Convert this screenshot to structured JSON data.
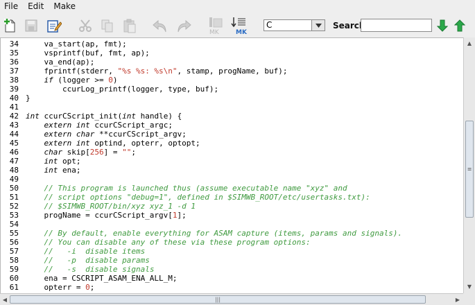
{
  "menu": {
    "file": "File",
    "edit": "Edit",
    "make": "Make"
  },
  "toolbar": {
    "icons": [
      "new-file-icon",
      "save-icon",
      "edit-file-icon",
      "cut-icon",
      "copy-icon",
      "paste-icon",
      "undo-icon",
      "redo-icon",
      "mk-disabled-icon",
      "mk-icon"
    ],
    "mk_label": "MK",
    "language_value": "C",
    "search_label": "Search:",
    "search_value": ""
  },
  "editor": {
    "lines": [
      {
        "n": "34",
        "parts": [
          [
            "",
            "    va_start(ap, fmt);"
          ]
        ]
      },
      {
        "n": "35",
        "parts": [
          [
            "",
            "    vsprintf(buf, fmt, ap);"
          ]
        ]
      },
      {
        "n": "36",
        "parts": [
          [
            "",
            "    va_end(ap);"
          ]
        ]
      },
      {
        "n": "37",
        "parts": [
          [
            "",
            "    fprintf(stderr, "
          ],
          [
            "st",
            "\"%s %s: %s\\n\""
          ],
          [
            "",
            ", stamp, progName, buf);"
          ]
        ]
      },
      {
        "n": "38",
        "parts": [
          [
            "",
            "    "
          ],
          [
            "kw",
            "if"
          ],
          [
            "",
            " (logger >= "
          ],
          [
            "nm",
            "0"
          ],
          [
            "",
            ")"
          ]
        ]
      },
      {
        "n": "39",
        "parts": [
          [
            "",
            "        ccurLog_printf(logger, type, buf);"
          ]
        ]
      },
      {
        "n": "40",
        "parts": [
          [
            "",
            "}"
          ]
        ]
      },
      {
        "n": "41",
        "parts": [
          [
            "",
            ""
          ]
        ]
      },
      {
        "n": "42",
        "parts": [
          [
            "kw",
            "int"
          ],
          [
            "",
            " ccurCScript_init("
          ],
          [
            "kw",
            "int"
          ],
          [
            "",
            " handle) {"
          ]
        ]
      },
      {
        "n": "43",
        "parts": [
          [
            "",
            "    "
          ],
          [
            "kw",
            "extern int"
          ],
          [
            "",
            " ccurCScript_argc;"
          ]
        ]
      },
      {
        "n": "44",
        "parts": [
          [
            "",
            "    "
          ],
          [
            "kw",
            "extern char"
          ],
          [
            "",
            " **ccurCScript_argv;"
          ]
        ]
      },
      {
        "n": "45",
        "parts": [
          [
            "",
            "    "
          ],
          [
            "kw",
            "extern int"
          ],
          [
            "",
            " optind, opterr, optopt;"
          ]
        ]
      },
      {
        "n": "46",
        "parts": [
          [
            "",
            "    "
          ],
          [
            "kw",
            "char"
          ],
          [
            "",
            " skip["
          ],
          [
            "nm",
            "256"
          ],
          [
            "",
            "] = "
          ],
          [
            "st",
            "\"\""
          ],
          [
            "",
            ";"
          ]
        ]
      },
      {
        "n": "47",
        "parts": [
          [
            "",
            "    "
          ],
          [
            "kw",
            "int"
          ],
          [
            "",
            " opt;"
          ]
        ]
      },
      {
        "n": "48",
        "parts": [
          [
            "",
            "    "
          ],
          [
            "kw",
            "int"
          ],
          [
            "",
            " ena;"
          ]
        ]
      },
      {
        "n": "49",
        "parts": [
          [
            "",
            ""
          ]
        ]
      },
      {
        "n": "50",
        "parts": [
          [
            "",
            "    "
          ],
          [
            "cm",
            "// This program is launched thus (assume executable name \"xyz\" and"
          ]
        ]
      },
      {
        "n": "51",
        "parts": [
          [
            "",
            "    "
          ],
          [
            "cm",
            "// script options \"debug=1\", defined in $SIMWB_ROOT/etc/usertasks.txt):"
          ]
        ]
      },
      {
        "n": "52",
        "parts": [
          [
            "",
            "    "
          ],
          [
            "cm",
            "// $SIMWB_ROOT/bin/xyz xyz_1 -d 1"
          ]
        ]
      },
      {
        "n": "53",
        "parts": [
          [
            "",
            "    progName = ccurCScript_argv["
          ],
          [
            "nm",
            "1"
          ],
          [
            "",
            "];"
          ]
        ]
      },
      {
        "n": "54",
        "parts": [
          [
            "",
            ""
          ]
        ]
      },
      {
        "n": "55",
        "parts": [
          [
            "",
            "    "
          ],
          [
            "cm",
            "// By default, enable everything for ASAM capture (items, params and signals)."
          ]
        ]
      },
      {
        "n": "56",
        "parts": [
          [
            "",
            "    "
          ],
          [
            "cm",
            "// You can disable any of these via these program options:"
          ]
        ]
      },
      {
        "n": "57",
        "parts": [
          [
            "",
            "    "
          ],
          [
            "cm",
            "//   -i  disable items"
          ]
        ]
      },
      {
        "n": "58",
        "parts": [
          [
            "",
            "    "
          ],
          [
            "cm",
            "//   -p  disable params"
          ]
        ]
      },
      {
        "n": "59",
        "parts": [
          [
            "",
            "    "
          ],
          [
            "cm",
            "//   -s  disable signals"
          ]
        ]
      },
      {
        "n": "60",
        "parts": [
          [
            "",
            "    ena = CSCRIPT_ASAM_ENA_ALL_M;"
          ]
        ]
      },
      {
        "n": "61",
        "parts": [
          [
            "",
            "    opterr = "
          ],
          [
            "nm",
            "0"
          ],
          [
            "",
            ";"
          ]
        ]
      }
    ]
  }
}
